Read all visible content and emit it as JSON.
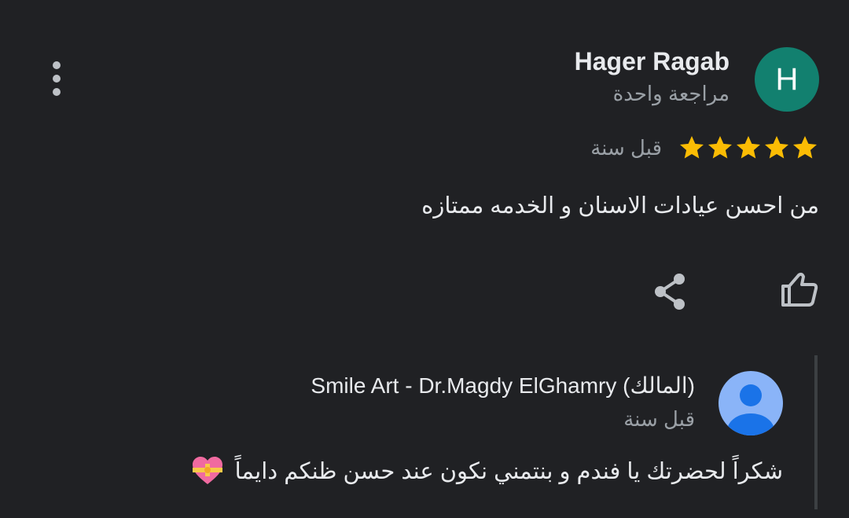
{
  "review": {
    "avatar_letter": "H",
    "avatar_color": "#12806f",
    "reviewer_name": "Hager Ragab",
    "review_count": "مراجعة واحدة",
    "rating": 5,
    "rating_max": 5,
    "star_color": "#fbbc04",
    "time": "قبل سنة",
    "text": "من احسن عيادات الاسنان و الخدمه ممتازه"
  },
  "icons": {
    "more": "more-vert-icon",
    "like": "thumb-up-icon",
    "share": "share-icon"
  },
  "owner_response": {
    "avatar_icon": "default-profile-icon",
    "avatar_color": "#8ab4f8",
    "name": "Smile Art - Dr.Magdy ElGhamry (المالك)",
    "time": "قبل سنة",
    "text": "شكراً لحضرتك يا فندم و بنتمني نكون عند حسن ظنكم دايماً",
    "emoji": "heart-with-ribbon-icon"
  }
}
